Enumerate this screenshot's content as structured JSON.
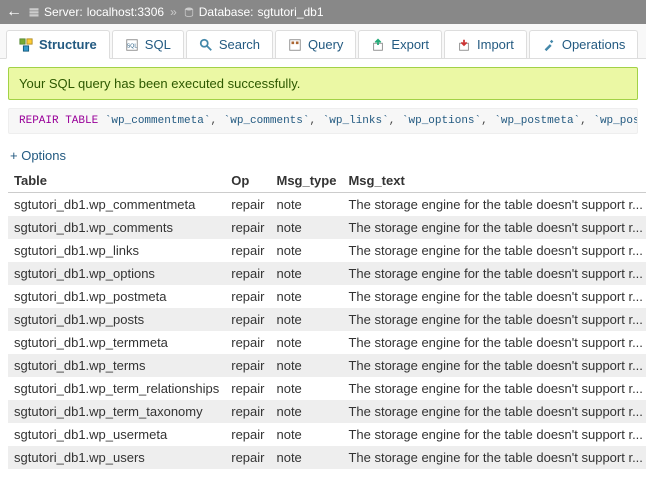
{
  "breadcrumb": {
    "server_label": "Server:",
    "server_value": "localhost:3306",
    "database_label": "Database:",
    "database_value": "sgtutori_db1"
  },
  "tabs": [
    {
      "label": "Structure",
      "icon": "structure"
    },
    {
      "label": "SQL",
      "icon": "sql"
    },
    {
      "label": "Search",
      "icon": "search"
    },
    {
      "label": "Query",
      "icon": "query"
    },
    {
      "label": "Export",
      "icon": "export"
    },
    {
      "label": "Import",
      "icon": "import"
    },
    {
      "label": "Operations",
      "icon": "operations"
    }
  ],
  "success_message": "Your SQL query has been executed successfully.",
  "sql": {
    "keyword": "REPAIR TABLE",
    "tables": [
      "wp_commentmeta",
      "wp_comments",
      "wp_links",
      "wp_options",
      "wp_postmeta",
      "wp_posts"
    ]
  },
  "options_label": "+ Options",
  "columns": [
    "Table",
    "Op",
    "Msg_type",
    "Msg_text"
  ],
  "rows": [
    {
      "table": "sgtutori_db1.wp_commentmeta",
      "op": "repair",
      "msg_type": "note",
      "msg_text": "The storage engine for the table doesn't support r..."
    },
    {
      "table": "sgtutori_db1.wp_comments",
      "op": "repair",
      "msg_type": "note",
      "msg_text": "The storage engine for the table doesn't support r..."
    },
    {
      "table": "sgtutori_db1.wp_links",
      "op": "repair",
      "msg_type": "note",
      "msg_text": "The storage engine for the table doesn't support r..."
    },
    {
      "table": "sgtutori_db1.wp_options",
      "op": "repair",
      "msg_type": "note",
      "msg_text": "The storage engine for the table doesn't support r..."
    },
    {
      "table": "sgtutori_db1.wp_postmeta",
      "op": "repair",
      "msg_type": "note",
      "msg_text": "The storage engine for the table doesn't support r..."
    },
    {
      "table": "sgtutori_db1.wp_posts",
      "op": "repair",
      "msg_type": "note",
      "msg_text": "The storage engine for the table doesn't support r..."
    },
    {
      "table": "sgtutori_db1.wp_termmeta",
      "op": "repair",
      "msg_type": "note",
      "msg_text": "The storage engine for the table doesn't support r..."
    },
    {
      "table": "sgtutori_db1.wp_terms",
      "op": "repair",
      "msg_type": "note",
      "msg_text": "The storage engine for the table doesn't support r..."
    },
    {
      "table": "sgtutori_db1.wp_term_relationships",
      "op": "repair",
      "msg_type": "note",
      "msg_text": "The storage engine for the table doesn't support r..."
    },
    {
      "table": "sgtutori_db1.wp_term_taxonomy",
      "op": "repair",
      "msg_type": "note",
      "msg_text": "The storage engine for the table doesn't support r..."
    },
    {
      "table": "sgtutori_db1.wp_usermeta",
      "op": "repair",
      "msg_type": "note",
      "msg_text": "The storage engine for the table doesn't support r..."
    },
    {
      "table": "sgtutori_db1.wp_users",
      "op": "repair",
      "msg_type": "note",
      "msg_text": "The storage engine for the table doesn't support r..."
    }
  ]
}
